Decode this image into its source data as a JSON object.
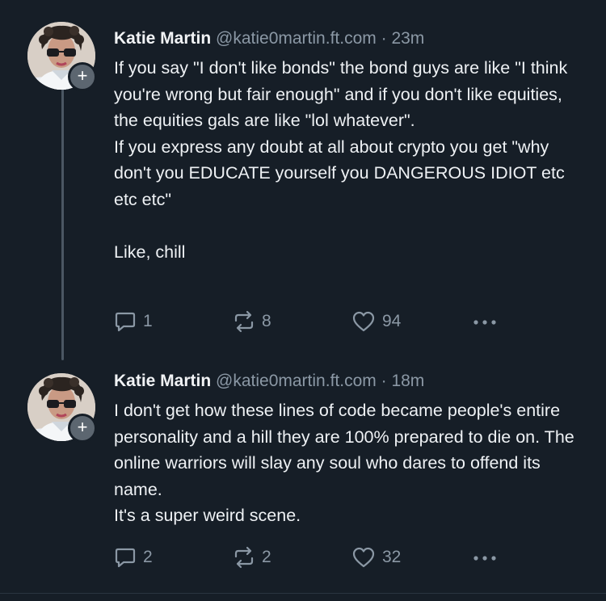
{
  "posts": [
    {
      "author": {
        "name": "Katie Martin",
        "handle": "@katie0martin.ft.com",
        "avatar_icon": "profile-photo",
        "follow_icon": "plus-icon",
        "follow_symbol": "+"
      },
      "separator": "·",
      "time": "23m",
      "paragraphs": [
        "If you say \"I don't like bonds\" the bond guys are like \"I think you're wrong but fair enough\" and if you don't like equities, the equities gals are like \"lol whatever\".",
        "If you express any doubt at all about crypto you get \"why don't you EDUCATE yourself you DANGEROUS IDIOT etc etc etc\"",
        "",
        "Like, chill"
      ],
      "stats": {
        "replies": "1",
        "reposts": "8",
        "likes": "94"
      }
    },
    {
      "author": {
        "name": "Katie Martin",
        "handle": "@katie0martin.ft.com",
        "avatar_icon": "profile-photo",
        "follow_icon": "plus-icon",
        "follow_symbol": "+"
      },
      "separator": "·",
      "time": "18m",
      "paragraphs": [
        "I don't get how these lines of code became people's entire personality and a hill they are 100% prepared to die on. The online warriors will slay any soul who dares to offend its name.",
        "It's a super weird scene."
      ],
      "stats": {
        "replies": "2",
        "reposts": "2",
        "likes": "32"
      }
    }
  ],
  "icons": {
    "reply": "speech-bubble-icon",
    "repost": "repost-arrows-icon",
    "like": "heart-icon",
    "more": "ellipsis-icon"
  },
  "colors": {
    "background": "#161e27",
    "text": "#f1f3f5",
    "muted": "#8b98a5",
    "thread_line": "#4b5763"
  }
}
